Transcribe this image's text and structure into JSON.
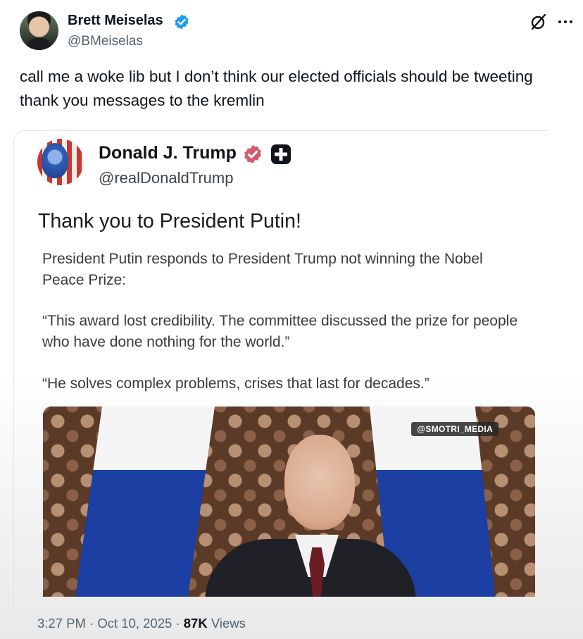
{
  "author": {
    "name": "Brett Meiselas",
    "handle": "@BMeiselas",
    "verified": true,
    "verified_color": "#1d9bf0"
  },
  "tweet": {
    "text": "call me a woke lib but I don’t think our elected officials should be tweeting\nthank you messages to the kremlin"
  },
  "quoted_post": {
    "name": "Donald J. Trump",
    "handle": "@realDonaldTrump",
    "verified_color": "#d65a6e",
    "title": "Thank you to President Putin!",
    "paragraphs": [
      "President Putin responds to President Trump not winning the Nobel Peace Prize:",
      "“This award lost credibility. The committee discussed the prize for people who have done nothing for the world.”",
      "“He solves complex problems, crises that last for decades.”"
    ],
    "media": {
      "watermark": "@SMOTRI_MEDIA"
    }
  },
  "footer": {
    "time": "3:27 PM",
    "sep1": "·",
    "date": "Oct 10, 2025",
    "sep2": "·",
    "views_count": "87K",
    "views_label": "Views"
  },
  "icons": {
    "grok": "grok-icon",
    "more": "more-icon",
    "verified": "verified-badge-icon",
    "plus": "plus-badge-icon"
  }
}
